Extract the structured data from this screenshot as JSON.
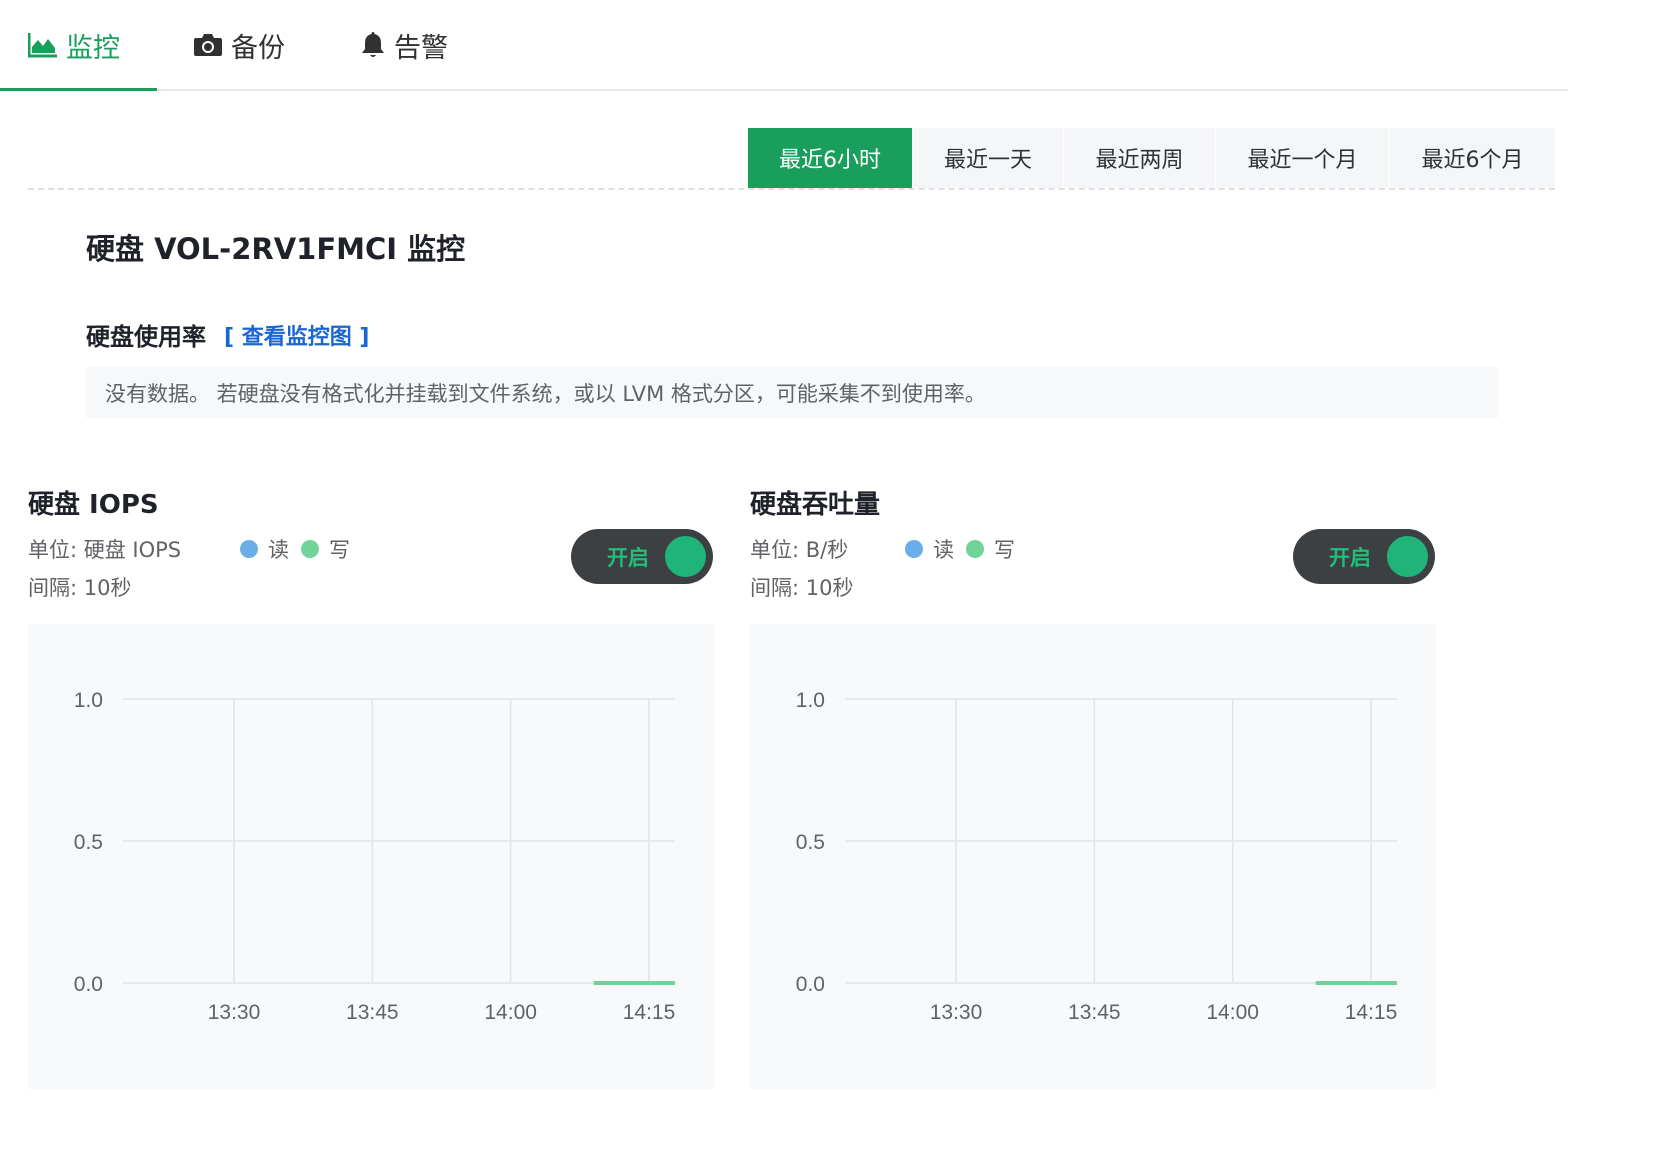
{
  "tabs": [
    {
      "label": "监控",
      "icon": "area-chart-icon",
      "active": true
    },
    {
      "label": "备份",
      "icon": "camera-icon",
      "active": false
    },
    {
      "label": "告警",
      "icon": "bell-icon",
      "active": false
    }
  ],
  "time_range": {
    "options": [
      "最近6小时",
      "最近一天",
      "最近两周",
      "最近一个月",
      "最近6个月"
    ],
    "selected": "最近6小时"
  },
  "page_title": "硬盘 VOL-2RV1FMCI 监控",
  "usage": {
    "title": "硬盘使用率",
    "link": "[ 查看监控图 ]",
    "notice": "没有数据。 若硬盘没有格式化并挂载到文件系统，或以 LVM 格式分区，可能采集不到使用率。"
  },
  "colors": {
    "accent": "#1a9e5c",
    "read": "#6aaee9",
    "write": "#6fd39a",
    "link": "#1a66d4"
  },
  "panels": [
    {
      "title": "硬盘 IOPS",
      "unit": "单位: 硬盘 IOPS",
      "interval": "间隔: 10秒",
      "legend_read": "读",
      "legend_write": "写",
      "toggle": "开启"
    },
    {
      "title": "硬盘吞吐量",
      "unit": "单位: B/秒",
      "interval": "间隔: 10秒",
      "legend_read": "读",
      "legend_write": "写",
      "toggle": "开启"
    }
  ],
  "chart_data": [
    {
      "type": "line",
      "title": "硬盘 IOPS",
      "x": [
        "13:30",
        "13:45",
        "14:00",
        "14:15"
      ],
      "yticks": [
        "1.0",
        "0.5",
        "0.0"
      ],
      "ylim": [
        0,
        1
      ],
      "grid": true,
      "series": [
        {
          "name": "读",
          "color": "#6aaee9",
          "x": [],
          "values": []
        },
        {
          "name": "写",
          "color": "#6fd39a",
          "x": [
            "14:09",
            "14:18"
          ],
          "values": [
            0,
            0
          ]
        }
      ]
    },
    {
      "type": "line",
      "title": "硬盘吞吐量",
      "x": [
        "13:30",
        "13:45",
        "14:00",
        "14:15"
      ],
      "yticks": [
        "1.0",
        "0.5",
        "0.0"
      ],
      "ylim": [
        0,
        1
      ],
      "grid": true,
      "series": [
        {
          "name": "读",
          "color": "#6aaee9",
          "x": [],
          "values": []
        },
        {
          "name": "写",
          "color": "#6fd39a",
          "x": [
            "14:09",
            "14:18"
          ],
          "values": [
            0,
            0
          ]
        }
      ]
    }
  ]
}
